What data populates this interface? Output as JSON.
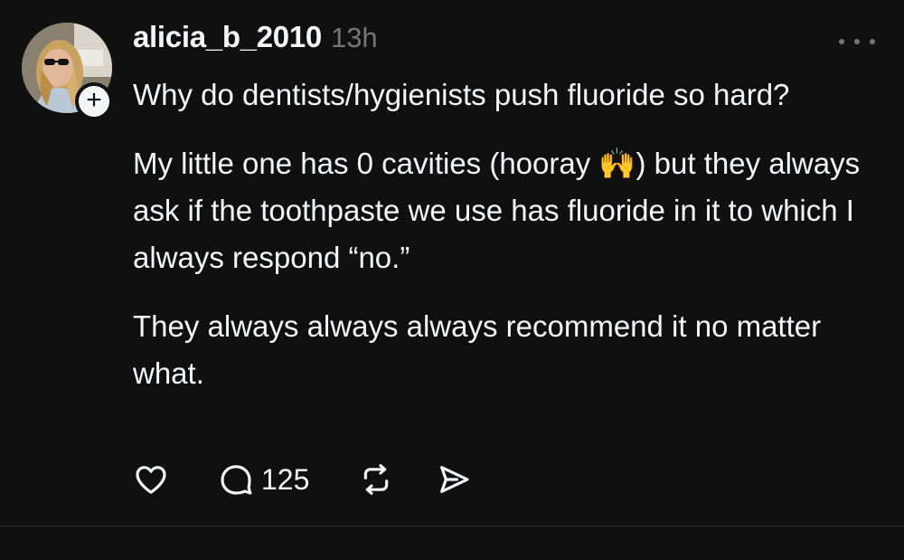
{
  "post": {
    "username": "alicia_b_2010",
    "time": "13h",
    "paragraphs": [
      "Why do dentists/hygienists push fluoride so hard?",
      "My little one has 0 cavities (hooray 🙌) but they always ask if the toothpaste we use has fluoride in it to which I always respond “no.”",
      "They always always always recommend it no matter what."
    ],
    "follow_icon": "plus",
    "more_icon": "ellipsis-horizontal",
    "actions": {
      "like_icon": "heart-outline",
      "reply_icon": "speech-bubble-outline",
      "reply_count": "125",
      "repost_icon": "repost-arrows",
      "share_icon": "paper-plane-outline"
    }
  },
  "colors": {
    "background": "#101010",
    "text_primary": "#f3f5f7",
    "text_secondary": "#777777",
    "divider": "#2d2d2d"
  }
}
